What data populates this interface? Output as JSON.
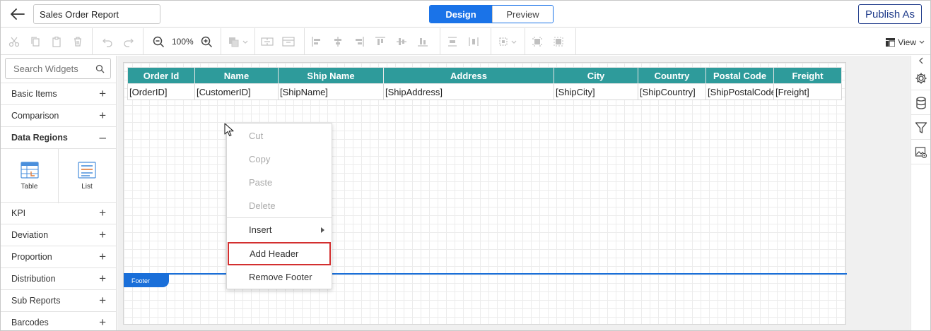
{
  "header": {
    "report_name": "Sales Order Report",
    "modes": {
      "design": "Design",
      "preview": "Preview"
    },
    "publish_label": "Publish As"
  },
  "toolbar": {
    "zoom_level": "100%",
    "view_label": "View"
  },
  "left_panel": {
    "search_placeholder": "Search Widgets",
    "categories": [
      {
        "label": "Basic Items",
        "sign": "+"
      },
      {
        "label": "Comparison",
        "sign": "+"
      },
      {
        "label": "Data Regions",
        "sign": "–"
      },
      {
        "label": "KPI",
        "sign": "+"
      },
      {
        "label": "Deviation",
        "sign": "+"
      },
      {
        "label": "Proportion",
        "sign": "+"
      },
      {
        "label": "Distribution",
        "sign": "+"
      },
      {
        "label": "Sub Reports",
        "sign": "+"
      },
      {
        "label": "Barcodes",
        "sign": "+"
      }
    ],
    "widgets": [
      {
        "label": "Table",
        "icon": "table-icon"
      },
      {
        "label": "List",
        "icon": "list-icon"
      }
    ]
  },
  "table": {
    "headers": [
      "Order Id",
      "Name",
      "Ship Name",
      "Address",
      "City",
      "Country",
      "Postal Code",
      "Freight"
    ],
    "cells": [
      "[OrderID]",
      "[CustomerID]",
      "[ShipName]",
      "[ShipAddress]",
      "[ShipCity]",
      "[ShipCountry]",
      "[ShipPostalCode]",
      "[Freight]"
    ],
    "header_color": "#2e9b9b"
  },
  "footer": {
    "label": "Footer",
    "color": "#1a6fd9"
  },
  "context_menu": {
    "items": [
      {
        "label": "Cut",
        "enabled": false
      },
      {
        "label": "Copy",
        "enabled": false
      },
      {
        "label": "Paste",
        "enabled": false
      },
      {
        "label": "Delete",
        "enabled": false
      },
      {
        "label": "Insert",
        "enabled": true,
        "submenu": true
      },
      {
        "label": "Add Header",
        "enabled": true,
        "highlighted": true
      },
      {
        "label": "Remove Footer",
        "enabled": true
      }
    ]
  },
  "right_panel": {
    "icons": [
      "chevron-left-icon",
      "gear-icon",
      "database-icon",
      "filter-icon",
      "image-settings-icon"
    ]
  }
}
